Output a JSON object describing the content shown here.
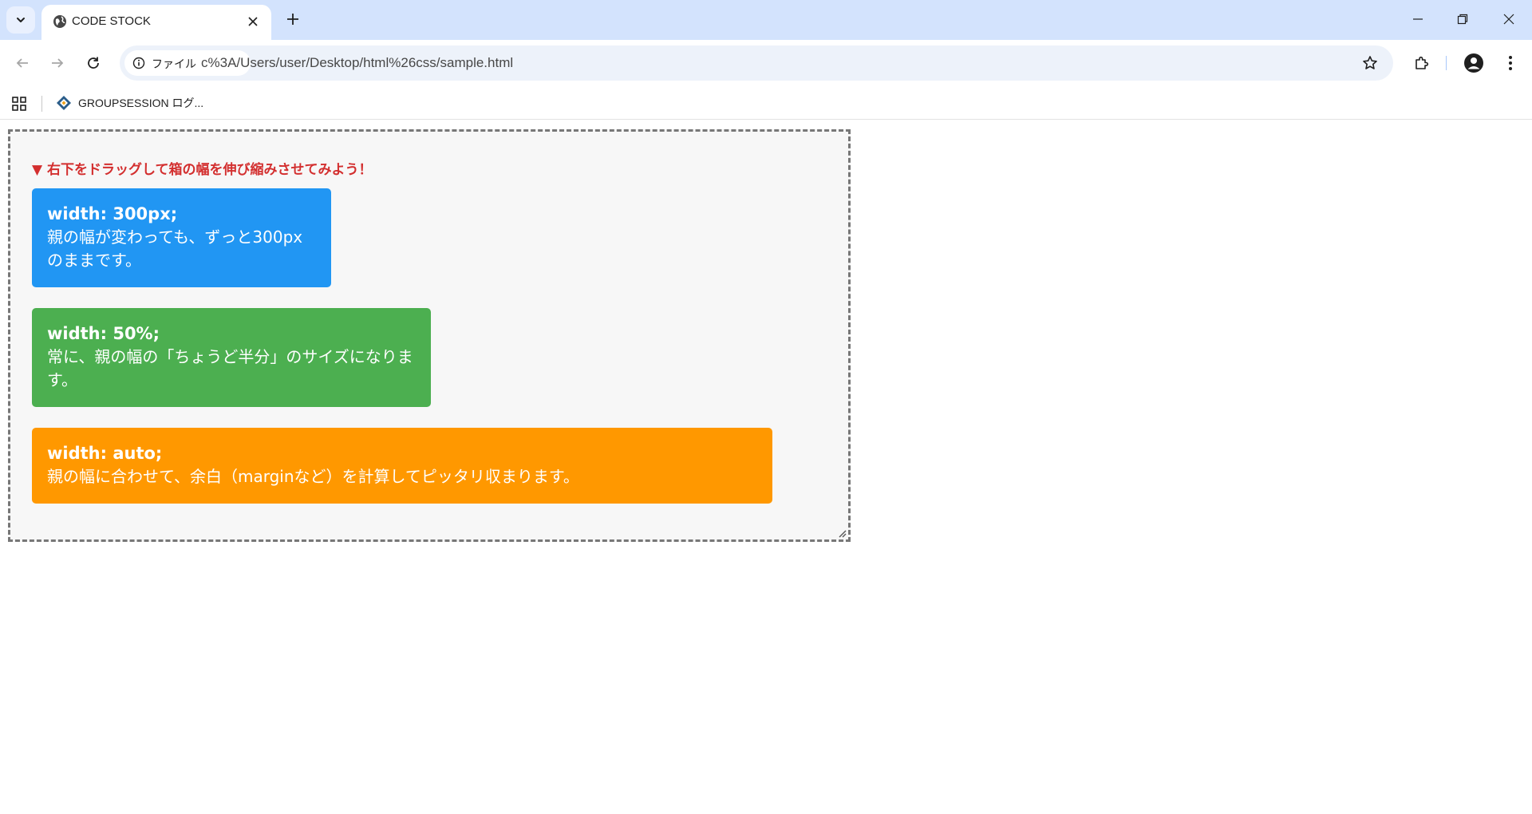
{
  "browser": {
    "tab": {
      "title": "CODE STOCK",
      "favicon": "globe-icon"
    },
    "address_bar": {
      "security_chip": "ファイル",
      "url": "c%3A/Users/user/Desktop/html%26css/sample.html"
    },
    "bookmarks": [
      {
        "label": "GROUPSESSION ログ...",
        "icon": "groupsession-icon"
      }
    ],
    "colors": {
      "frame": "#d3e3fd",
      "omnibox": "#edf2fa"
    }
  },
  "page": {
    "hint": "▼ 右下をドラッグして箱の幅を伸び縮みさせてみよう！",
    "boxes": [
      {
        "title": "width: 300px;",
        "description": "親の幅が変わっても、ずっと300pxのままです。",
        "color": "#2196f3"
      },
      {
        "title": "width: 50%;",
        "description": "常に、親の幅の「ちょうど半分」のサイズになります。",
        "color": "#4caf50"
      },
      {
        "title": "width: auto;",
        "description": "親の幅に合わせて、余白（marginなど）を計算してピッタリ収まります。",
        "color": "#ff9800"
      }
    ],
    "colors": {
      "container_bg": "#f7f7f7",
      "hint_text": "#d32f2f",
      "container_border": "#777777"
    }
  }
}
